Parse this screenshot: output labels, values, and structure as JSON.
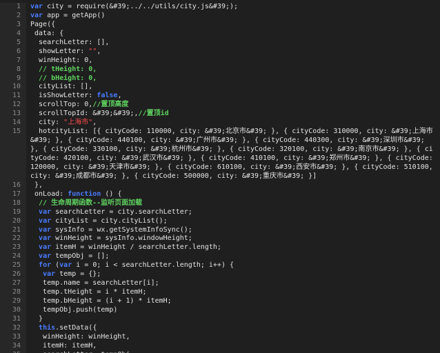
{
  "editor": {
    "lines": [
      {
        "n": "1",
        "parts": [
          [
            "kw",
            "var"
          ],
          [
            "t",
            " city = require(&#39;../../utils/city.js&#39;);"
          ]
        ]
      },
      {
        "n": "2",
        "parts": [
          [
            "kw",
            "var"
          ],
          [
            "t",
            " app = getApp()"
          ]
        ]
      },
      {
        "n": "3",
        "parts": [
          [
            "t",
            "Page({"
          ]
        ]
      },
      {
        "n": "4",
        "parts": [
          [
            "t",
            " data: {"
          ]
        ]
      },
      {
        "n": "5",
        "parts": [
          [
            "t",
            "  searchLetter: [],"
          ]
        ]
      },
      {
        "n": "6",
        "parts": [
          [
            "t",
            "  showLetter: "
          ],
          [
            "str",
            "\"\""
          ],
          [
            "t",
            ","
          ]
        ]
      },
      {
        "n": "7",
        "parts": [
          [
            "t",
            "  winHeight: 0,"
          ]
        ]
      },
      {
        "n": "8",
        "parts": [
          [
            "cm",
            "  // tHeight: 0,"
          ]
        ]
      },
      {
        "n": "9",
        "parts": [
          [
            "cm",
            "  // bHeight: 0,"
          ]
        ]
      },
      {
        "n": "10",
        "parts": [
          [
            "t",
            "  cityList: [],"
          ]
        ]
      },
      {
        "n": "11",
        "parts": [
          [
            "t",
            "  isShowLetter: "
          ],
          [
            "bool",
            "false"
          ],
          [
            "t",
            ","
          ]
        ]
      },
      {
        "n": "12",
        "parts": [
          [
            "t",
            "  scrollTop: 0,"
          ],
          [
            "cm",
            "//置顶高度"
          ]
        ]
      },
      {
        "n": "13",
        "parts": [
          [
            "t",
            "  scrollTopId: &#39;&#39;,"
          ],
          [
            "cm",
            "//置顶id"
          ]
        ]
      },
      {
        "n": "14",
        "parts": [
          [
            "t",
            "  city: "
          ],
          [
            "str",
            "\"上海市\""
          ],
          [
            "t",
            ","
          ]
        ]
      },
      {
        "n": "15",
        "wrap": true,
        "rows": 3,
        "parts": [
          [
            "t",
            "  hotcityList: [{ cityCode: 110000, city: &#39;北京市&#39; }, { cityCode: 310000, city: &#39;上海市&#39; }, { cityCode: 440100, city: &#39;广州市&#39; }, { cityCode: 440300, city: &#39;深圳市&#39; }, { cityCode: 330100, city: &#39;杭州市&#39; }, { cityCode: 320100, city: &#39;南京市&#39; }, { cityCode: 420100, city: &#39;武汉市&#39; }, { cityCode: 410100, city: &#39;郑州市&#39; }, { cityCode: 120000, city: &#39;天津市&#39; }, { cityCode: 610100, city: &#39;西安市&#39; }, { cityCode: 510100, city: &#39;成都市&#39; }, { cityCode: 500000, city: &#39;重庆市&#39; }]"
          ]
        ]
      },
      {
        "n": "16",
        "parts": [
          [
            "t",
            " },"
          ]
        ]
      },
      {
        "n": "17",
        "parts": [
          [
            "t",
            " onLoad: "
          ],
          [
            "kw",
            "function"
          ],
          [
            "t",
            " () {"
          ]
        ]
      },
      {
        "n": "18",
        "parts": [
          [
            "cm",
            "  // 生命周期函数--监听页面加载"
          ]
        ]
      },
      {
        "n": "19",
        "parts": [
          [
            "t",
            "  "
          ],
          [
            "kw",
            "var"
          ],
          [
            "t",
            " searchLetter = city.searchLetter;"
          ]
        ]
      },
      {
        "n": "20",
        "parts": [
          [
            "t",
            "  "
          ],
          [
            "kw",
            "var"
          ],
          [
            "t",
            " cityList = city.cityList();"
          ]
        ]
      },
      {
        "n": "21",
        "parts": [
          [
            "t",
            "  "
          ],
          [
            "kw",
            "var"
          ],
          [
            "t",
            " sysInfo = wx.getSystemInfoSync();"
          ]
        ]
      },
      {
        "n": "22",
        "parts": [
          [
            "t",
            "  "
          ],
          [
            "kw",
            "var"
          ],
          [
            "t",
            " winHeight = sysInfo.windowHeight;"
          ]
        ]
      },
      {
        "n": "23",
        "parts": [
          [
            "t",
            "  "
          ],
          [
            "kw",
            "var"
          ],
          [
            "t",
            " itemH = winHeight / searchLetter.length;"
          ]
        ]
      },
      {
        "n": "24",
        "parts": [
          [
            "t",
            "  "
          ],
          [
            "kw",
            "var"
          ],
          [
            "t",
            " tempObj = [];"
          ]
        ]
      },
      {
        "n": "25",
        "parts": [
          [
            "t",
            "  "
          ],
          [
            "kw",
            "for"
          ],
          [
            "t",
            " ("
          ],
          [
            "kw",
            "var"
          ],
          [
            "t",
            " i = 0; i < searchLetter.length; i++) {"
          ]
        ]
      },
      {
        "n": "26",
        "parts": [
          [
            "t",
            "   "
          ],
          [
            "kw",
            "var"
          ],
          [
            "t",
            " temp = {};"
          ]
        ]
      },
      {
        "n": "27",
        "parts": [
          [
            "t",
            "   temp.name = searchLetter[i];"
          ]
        ]
      },
      {
        "n": "28",
        "parts": [
          [
            "t",
            "   temp.tHeight = i * itemH;"
          ]
        ]
      },
      {
        "n": "29",
        "parts": [
          [
            "t",
            "   temp.bHeight = (i + 1) * itemH;"
          ]
        ]
      },
      {
        "n": "30",
        "parts": [
          [
            "t",
            "   tempObj.push(temp)"
          ]
        ]
      },
      {
        "n": "31",
        "parts": [
          [
            "t",
            "  }"
          ]
        ]
      },
      {
        "n": "32",
        "parts": [
          [
            "t",
            "  "
          ],
          [
            "kw",
            "this"
          ],
          [
            "t",
            ".setData({"
          ]
        ]
      },
      {
        "n": "33",
        "parts": [
          [
            "t",
            "   winHeight: winHeight,"
          ]
        ]
      },
      {
        "n": "34",
        "parts": [
          [
            "t",
            "   itemH: itemH,"
          ]
        ]
      },
      {
        "n": "35",
        "parts": [
          [
            "t",
            "   searchLetter: tempObj,"
          ]
        ]
      }
    ],
    "colors": {
      "background": "#1f1f1f",
      "gutter": "#272727",
      "keyword": "#4a7cff",
      "comment": "#5fd15f",
      "string": "#ff4d4d",
      "text": "#e4e4e4"
    }
  }
}
